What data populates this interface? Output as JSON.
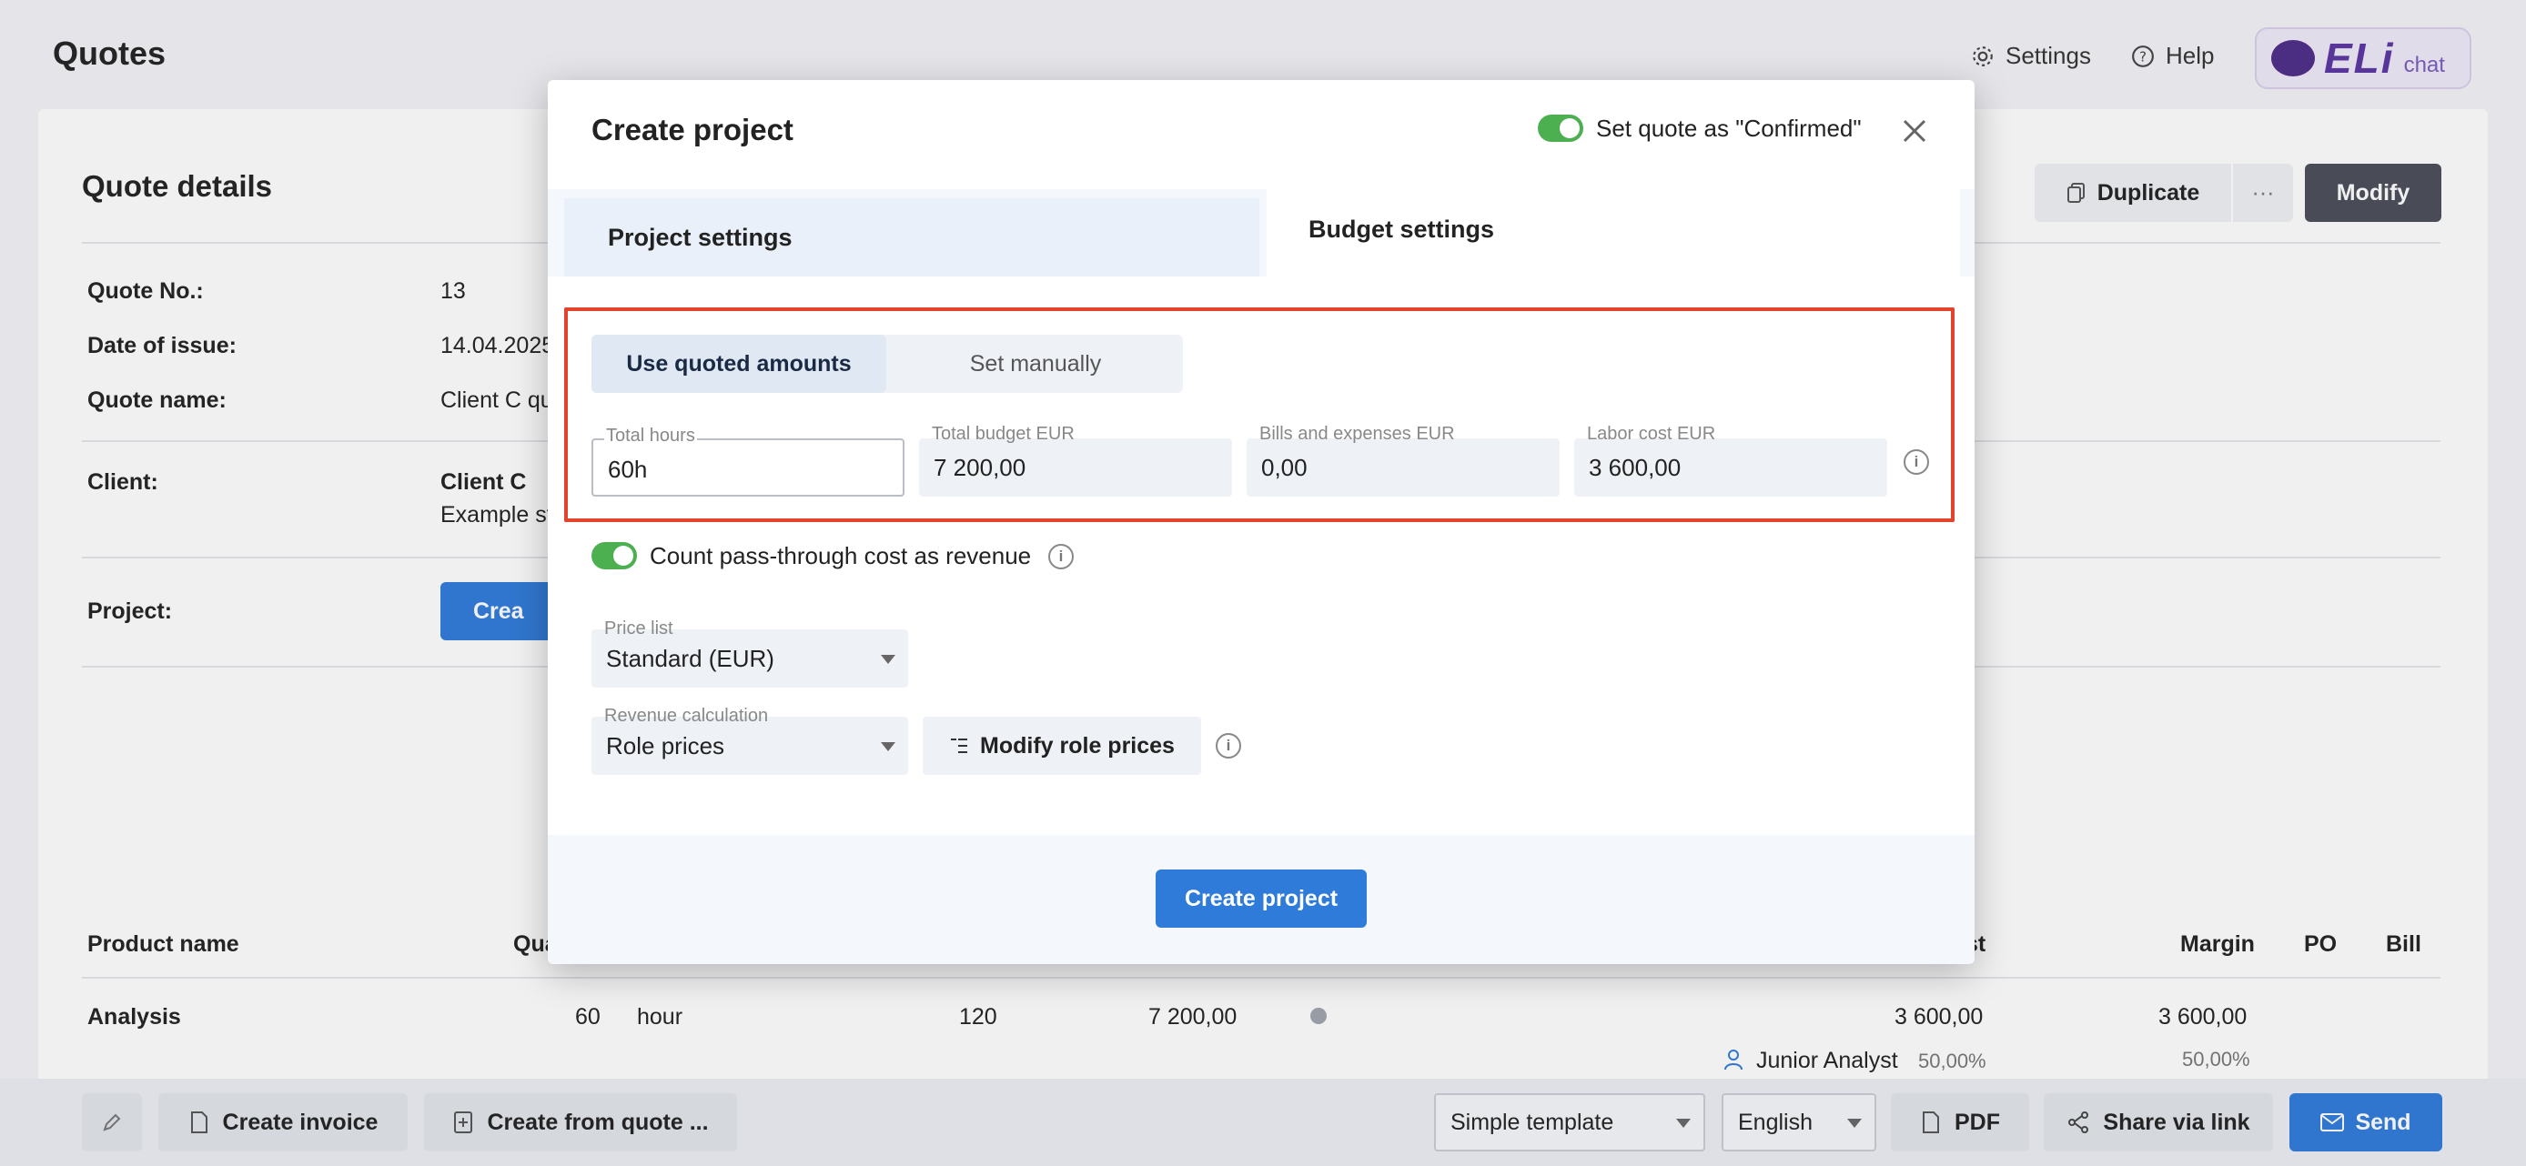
{
  "header": {
    "title": "Quotes",
    "settings_label": "Settings",
    "help_label": "Help",
    "eli_logo": "ELi",
    "eli_chat": "chat"
  },
  "quote": {
    "section_title": "Quote details",
    "duplicate_label": "Duplicate",
    "more_label": "···",
    "modify_label": "Modify",
    "fields": {
      "quote_no_label": "Quote No.:",
      "quote_no": "13",
      "date_label": "Date of issue:",
      "date": "14.04.2025",
      "name_label": "Quote name:",
      "name": "Client C qu",
      "client_label": "Client:",
      "client": "Client C",
      "client_address": "Example st",
      "project_label": "Project:",
      "project_button": "Crea"
    },
    "table": {
      "headers": [
        "Product name",
        "Qua",
        "st",
        "Margin",
        "PO",
        "Bill"
      ],
      "row": {
        "product": "Analysis",
        "quantity": "60",
        "unit": "hour",
        "price": "120",
        "total": "7 200,00",
        "cost": "3 600,00",
        "margin": "3 600,00"
      },
      "sub_row": {
        "role": "Junior Analyst",
        "role_percent": "50,00%",
        "margin_percent": "50,00%"
      }
    }
  },
  "bottom_bar": {
    "create_invoice": "Create invoice",
    "create_from_quote": "Create from quote ...",
    "template": "Simple template",
    "language": "English",
    "pdf": "PDF",
    "share": "Share via link",
    "send": "Send"
  },
  "modal": {
    "title": "Create project",
    "confirm_toggle_label": "Set quote as \"Confirmed\"",
    "tabs": [
      {
        "label": "Project settings"
      },
      {
        "label": "Budget settings"
      }
    ],
    "segment": {
      "option_on": "Use quoted amounts",
      "option_off": "Set manually"
    },
    "fields": [
      {
        "label": "Total hours",
        "value": "60h"
      },
      {
        "label": "Total budget EUR",
        "value": "7 200,00"
      },
      {
        "label": "Bills and expenses EUR",
        "value": "0,00"
      },
      {
        "label": "Labor cost EUR",
        "value": "3 600,00"
      }
    ],
    "passthrough_label": "Count pass-through cost as revenue",
    "price_list": {
      "label": "Price list",
      "value": "Standard (EUR)"
    },
    "revenue_calc": {
      "label": "Revenue calculation",
      "value": "Role prices"
    },
    "modify_role_prices": "Modify role prices",
    "create_button": "Create project",
    "info_glyph": "i"
  },
  "colors": {
    "accent": "#2f7bd9",
    "toggle_on": "#4caf50",
    "highlight": "#e4432b",
    "dark_button": "#4a4e58"
  }
}
